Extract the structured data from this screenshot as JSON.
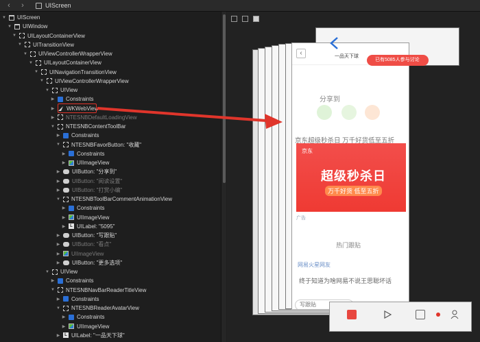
{
  "window": {
    "title": "UIScreen"
  },
  "tree": {
    "rows": [
      {
        "label": "UIScreen",
        "icon": "window-icon",
        "expanded": true,
        "dim": false
      },
      {
        "label": "UIWindow",
        "icon": "window-icon",
        "expanded": true,
        "dim": false
      },
      {
        "label": "UILayoutContainerView",
        "icon": "view-icon",
        "expanded": true,
        "dim": false
      },
      {
        "label": "UITransitionView",
        "icon": "view-icon",
        "expanded": true,
        "dim": false
      },
      {
        "label": "UIViewControllerWrapperView",
        "icon": "view-icon",
        "expanded": true,
        "dim": false
      },
      {
        "label": "UILayoutContainerView",
        "icon": "view-icon",
        "expanded": true,
        "dim": false
      },
      {
        "label": "UINavigationTransitionView",
        "icon": "view-icon",
        "expanded": true,
        "dim": false
      },
      {
        "label": "UIViewControllerWrapperView",
        "icon": "view-icon",
        "expanded": true,
        "dim": false
      },
      {
        "label": "UIView",
        "icon": "view-icon",
        "expanded": true,
        "dim": false
      },
      {
        "label": "Constraints",
        "icon": "constraints-icon",
        "expanded": false,
        "dim": false
      },
      {
        "label": "WKWebView",
        "icon": "webview-icon",
        "expanded": false,
        "dim": false
      },
      {
        "label": "NTESNBDefaultLoadingView",
        "icon": "view-icon",
        "expanded": false,
        "dim": true
      },
      {
        "label": "NTESNBContentToolBar",
        "icon": "view-icon",
        "expanded": true,
        "dim": false
      },
      {
        "label": "Constraints",
        "icon": "constraints-icon",
        "expanded": false,
        "dim": false
      },
      {
        "label": "NTESNBFavorButton: \"收藏\"",
        "icon": "view-icon",
        "expanded": true,
        "dim": false
      },
      {
        "label": "Constraints",
        "icon": "constraints-icon",
        "expanded": false,
        "dim": false
      },
      {
        "label": "UIImageView",
        "icon": "image-icon",
        "expanded": false,
        "dim": false
      },
      {
        "label": "UIButton: \"分享到\"",
        "icon": "button-icon",
        "expanded": false,
        "dim": false
      },
      {
        "label": "UIButton: \"阅读设置\"",
        "icon": "button-icon",
        "expanded": false,
        "dim": true
      },
      {
        "label": "UIButton: \"打赏小编\"",
        "icon": "button-icon",
        "expanded": false,
        "dim": true
      },
      {
        "label": "NTESNBToolBarCommentAnimationView",
        "icon": "view-icon",
        "expanded": true,
        "dim": false
      },
      {
        "label": "Constraints",
        "icon": "constraints-icon",
        "expanded": false,
        "dim": false
      },
      {
        "label": "UIImageView",
        "icon": "image-icon",
        "expanded": false,
        "dim": false
      },
      {
        "label": "UILabel: \"5095\"",
        "icon": "label-icon",
        "expanded": false,
        "dim": false
      },
      {
        "label": "UIButton: \"写跟贴\"",
        "icon": "button-icon",
        "expanded": false,
        "dim": false
      },
      {
        "label": "UIButton: \"看点\"",
        "icon": "button-icon",
        "expanded": false,
        "dim": true
      },
      {
        "label": "UIImageView",
        "icon": "image-icon",
        "expanded": false,
        "dim": true
      },
      {
        "label": "UIButton: \"更多选项\"",
        "icon": "button-icon",
        "expanded": false,
        "dim": false
      },
      {
        "label": "UIView",
        "icon": "view-icon",
        "expanded": true,
        "dim": false
      },
      {
        "label": "Constraints",
        "icon": "constraints-icon",
        "expanded": false,
        "dim": false
      },
      {
        "label": "NTESNBNavBarReaderTitleView",
        "icon": "view-icon",
        "expanded": true,
        "dim": false
      },
      {
        "label": "Constraints",
        "icon": "constraints-icon",
        "expanded": false,
        "dim": false
      },
      {
        "label": "NTESNBReaderAvatarView",
        "icon": "view-icon",
        "expanded": true,
        "dim": false
      },
      {
        "label": "Constraints",
        "icon": "constraints-icon",
        "expanded": false,
        "dim": false
      },
      {
        "label": "UIImageView",
        "icon": "image-icon",
        "expanded": false,
        "dim": false
      },
      {
        "label": "UILabel: \"一品天下球\"",
        "icon": "label-icon",
        "expanded": false,
        "dim": false
      }
    ]
  },
  "phone": {
    "share_label": "分享到",
    "article_title": "京东超级秒杀日 万千好货低至五折",
    "banner_big": "超级秒杀日",
    "banner_sub": "万千好货 低至五折",
    "banner_logo": "京东",
    "ad_label": "广告",
    "hot_label": "热门跟贴",
    "comment_user": "网易火星网友",
    "comment_text": "终于知道为啥网易不说王思聪坏话",
    "input_placeholder": "写跟贴",
    "nav_title": "一品天下球",
    "badge_text": "已有5085人参与讨论"
  },
  "colors": {
    "highlight": "#e0352b",
    "arrow": "#e0352b",
    "banner": "#ef3a33",
    "accent": "#2a6fd6"
  }
}
